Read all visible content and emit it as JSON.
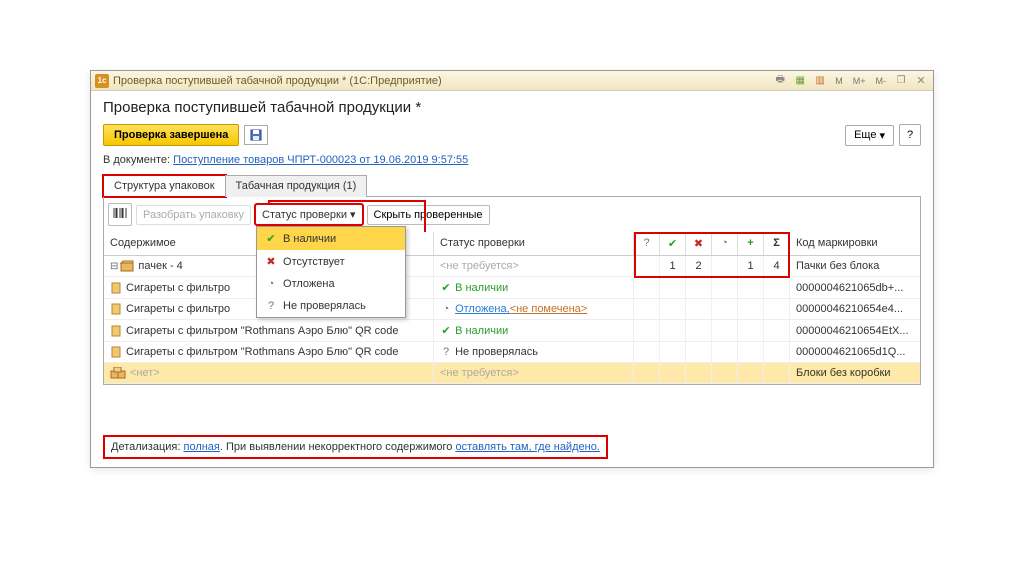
{
  "window": {
    "icon_text": "1c",
    "title": "Проверка поступившей табачной продукции * (1С:Предприятие)",
    "toolbtns": {
      "m": "M",
      "mplus": "M+",
      "mminus": "M-"
    }
  },
  "page": {
    "title": "Проверка поступившей табачной продукции *"
  },
  "toolbar": {
    "complete_label": "Проверка завершена",
    "more_label": "Еще",
    "help_label": "?"
  },
  "docline": {
    "prefix": "В документе: ",
    "link": "Поступление товаров ЧПРТ-000023 от 19.06.2019 9:57:55"
  },
  "tabs": [
    {
      "label": "Структура упаковок",
      "active": true
    },
    {
      "label": "Табачная продукция (1)",
      "active": false
    }
  ],
  "inner_toolbar": {
    "unpack_label": "Разобрать упаковку",
    "status_label": "Статус проверки",
    "hide_label": "Скрыть проверенные"
  },
  "status_menu": [
    {
      "icon": "ok",
      "label": "В наличии",
      "selected": true
    },
    {
      "icon": "x",
      "label": "Отсутствует",
      "selected": false
    },
    {
      "icon": "clock",
      "label": "Отложена",
      "selected": false
    },
    {
      "icon": "q",
      "label": "Не проверялась",
      "selected": false
    }
  ],
  "grid": {
    "headers": {
      "content": "Содержимое",
      "status": "Статус проверки",
      "mini": [
        "?",
        "✓",
        "✕",
        "⏱",
        "+",
        "Σ"
      ],
      "code": "Код маркировки"
    },
    "rows": [
      {
        "type": "group",
        "content": "пачек - 4",
        "status": "<не требуется>",
        "status_class": "gray",
        "mini": [
          "",
          "1",
          "2",
          "",
          "1",
          "4"
        ],
        "code": "Пачки без блока",
        "yellow": false
      },
      {
        "type": "item",
        "content": "Сигареты с фильтро",
        "status": "В наличии",
        "status_class": "green",
        "status_icon": "ok",
        "mini": [
          "",
          "",
          "",
          "",
          "",
          ""
        ],
        "code": "0000004621065db+...",
        "yellow": false
      },
      {
        "type": "item",
        "content": "Сигареты с фильтро",
        "status_html": true,
        "status_prefix": "Отложена, ",
        "status_suffix": "<не помечена>",
        "status_icon": "clock",
        "mini": [
          "",
          "",
          "",
          "",
          "",
          ""
        ],
        "code": "00000046210654e4...",
        "yellow": false
      },
      {
        "type": "item",
        "content": "Сигареты с фильтром \"Rothmans Аэро Блю\" QR code",
        "status": "В наличии",
        "status_class": "green",
        "status_icon": "ok",
        "mini": [
          "",
          "",
          "",
          "",
          "",
          ""
        ],
        "code": "00000046210654EtX...",
        "yellow": false
      },
      {
        "type": "item",
        "content": "Сигареты с фильтром \"Rothmans Аэро Блю\" QR code",
        "status": "Не проверялась",
        "status_class": "",
        "status_icon": "q",
        "mini": [
          "",
          "",
          "",
          "",
          "",
          ""
        ],
        "code": "0000004621065d1Q...",
        "yellow": false
      },
      {
        "type": "empty",
        "content": "<нет>",
        "status": "<не требуется>",
        "status_class": "gray",
        "mini": [
          "",
          "",
          "",
          "",
          "",
          ""
        ],
        "code": "Блоки без коробки",
        "yellow": true
      }
    ]
  },
  "footer": {
    "prefix": "Детализация: ",
    "link1": "полная",
    "mid": ". При выявлении некорректного содержимого ",
    "link2": "оставлять там, где найдено.",
    "suffix": ""
  },
  "icons": {
    "ok": "✔",
    "x": "✖",
    "clock": "◔",
    "q": "?",
    "plus": "+",
    "sum": "Σ",
    "chevron": "▾"
  }
}
